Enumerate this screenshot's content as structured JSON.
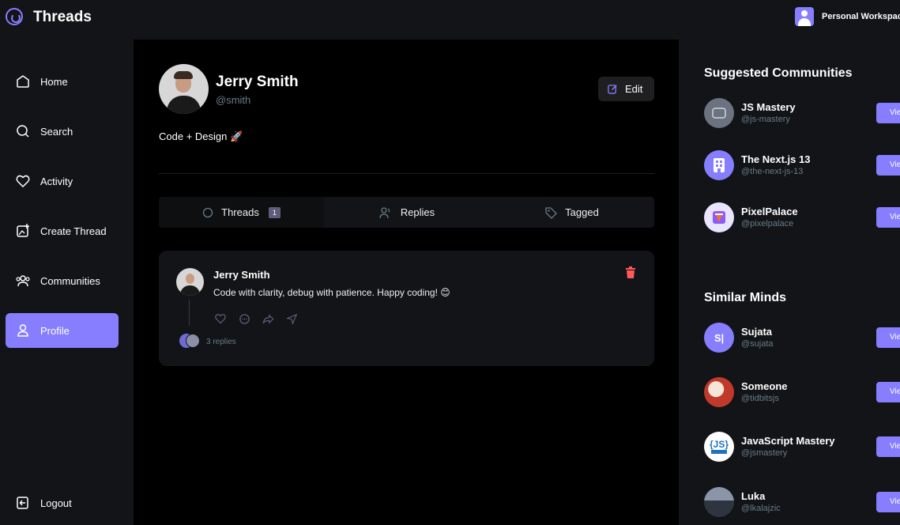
{
  "app": {
    "title": "Threads",
    "workspace": "Personal Workspace"
  },
  "sidebar": {
    "items": [
      {
        "label": "Home",
        "icon": "home-icon"
      },
      {
        "label": "Search",
        "icon": "search-icon"
      },
      {
        "label": "Activity",
        "icon": "heart-icon"
      },
      {
        "label": "Create Thread",
        "icon": "create-thread-icon"
      },
      {
        "label": "Communities",
        "icon": "communities-icon"
      },
      {
        "label": "Profile",
        "icon": "user-icon",
        "active": true
      }
    ],
    "logout": "Logout"
  },
  "profile": {
    "name": "Jerry Smith",
    "handle": "@smith",
    "bio": "Code + Design 🚀",
    "edit_label": "Edit"
  },
  "tabs": [
    {
      "label": "Threads",
      "count": "1",
      "icon": "threads-icon",
      "active": true
    },
    {
      "label": "Replies",
      "icon": "replies-icon"
    },
    {
      "label": "Tagged",
      "icon": "tag-icon"
    }
  ],
  "thread": {
    "author": "Jerry Smith",
    "content": "Code with clarity, debug with patience. Happy coding! 😊",
    "replies": "3 replies"
  },
  "suggested_communities": {
    "title": "Suggested Communities",
    "items": [
      {
        "name": "JS Mastery",
        "handle": "@js-mastery",
        "avatar_bg": "#6b7280"
      },
      {
        "name": "The Next.js 13",
        "handle": "@the-next-js-13",
        "avatar_bg": "#877eff"
      },
      {
        "name": "PixelPalace",
        "handle": "@pixelpalace",
        "avatar_bg": "#e9e4ff"
      }
    ]
  },
  "similar_minds": {
    "title": "Similar Minds",
    "items": [
      {
        "name": "Sujata",
        "handle": "@sujata",
        "initials": "S|",
        "avatar_bg": "#877eff"
      },
      {
        "name": "Someone",
        "handle": "@tidbitsjs",
        "avatar_bg": "#c0392b"
      },
      {
        "name": "JavaScript Mastery",
        "handle": "@jsmastery",
        "avatar_bg": "#ffffff"
      },
      {
        "name": "Luka",
        "handle": "@lkalajzic",
        "avatar_bg": "#5a6270"
      }
    ]
  },
  "view_label": "View",
  "colors": {
    "accent": "#877eff",
    "panel": "#121417",
    "muted": "#697c89",
    "danger": "#ff5a5a"
  }
}
